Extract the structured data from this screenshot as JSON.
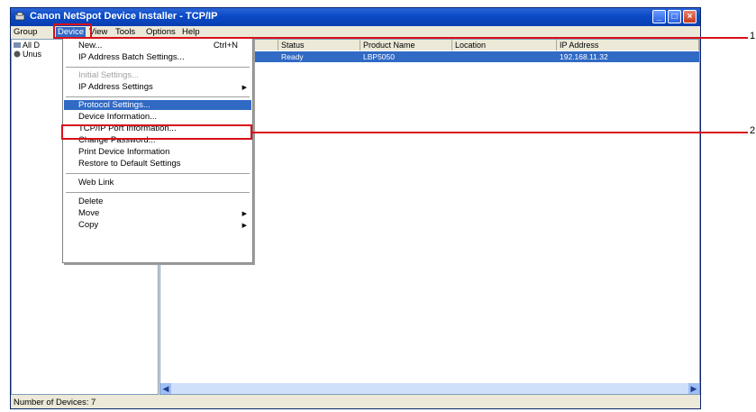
{
  "window": {
    "title": "Canon NetSpot Device Installer - TCP/IP",
    "buttons": {
      "minimize": "_",
      "maximize": "□",
      "close": "×"
    }
  },
  "menubar": [
    "Group",
    "Device",
    "View",
    "Tools",
    "Options",
    "Help"
  ],
  "tree": [
    {
      "label": "All D",
      "icon": "all-devices-icon"
    },
    {
      "label": "Unus",
      "icon": "unused-devices-icon"
    }
  ],
  "list": {
    "columns": [
      "",
      "Status",
      "Product Name",
      "Location",
      "IP Address"
    ],
    "rows": [
      {
        "name": "",
        "status": "Ready",
        "product": "LBP5050",
        "location": "",
        "ip": "192.168.11.32"
      }
    ]
  },
  "device_menu": [
    {
      "label": "New...",
      "shortcut": "Ctrl+N"
    },
    {
      "label": "IP Address Batch Settings..."
    },
    {
      "label": "Initial Settings...",
      "disabled": true
    },
    {
      "label": "IP Address Settings",
      "submenu": true
    },
    {
      "label": "Protocol Settings...",
      "highlighted": true
    },
    {
      "label": "Device Information..."
    },
    {
      "label": "TCP/IP Port Information..."
    },
    {
      "label": "Change Password..."
    },
    {
      "label": "Print Device Information"
    },
    {
      "label": "Restore to Default Settings"
    },
    {
      "label": "Web Link"
    },
    {
      "label": "Delete"
    },
    {
      "label": "Move",
      "submenu": true
    },
    {
      "label": "Copy",
      "submenu": true
    }
  ],
  "status_bar": "Number of Devices: 7",
  "callouts": [
    "1",
    "2"
  ],
  "colors": {
    "titlebar": "#0a4ac6",
    "selection": "#316ac5",
    "annotation": "#d8101a"
  }
}
